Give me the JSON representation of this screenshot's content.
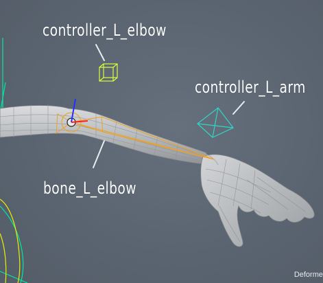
{
  "viewport": {
    "background": "#5b6470",
    "status_text": "Deforme"
  },
  "labels": {
    "controller_elbow": "controller_L_elbow",
    "controller_arm": "controller_L_arm",
    "bone_elbow": "bone_L_elbow"
  },
  "colors": {
    "controller_elbow": "#d9ff3a",
    "controller_arm": "#2fd6c6",
    "bone": "#f0a020",
    "joint_axis_y": "#2030ff",
    "joint_axis_x": "#ff2020",
    "guide_lines": "#00e8a0",
    "curve_yellow": "#e8f000",
    "mesh": "#c9cbcd"
  },
  "icons": {
    "controller_elbow": "cube-control-icon",
    "controller_arm": "pyramid-control-icon",
    "joint": "joint-sphere-icon"
  }
}
